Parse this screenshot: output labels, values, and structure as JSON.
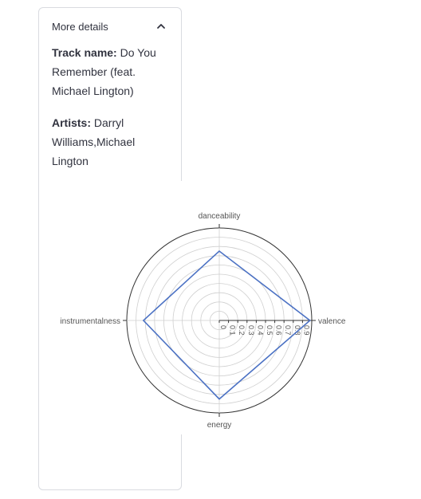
{
  "expander": {
    "title": "More details",
    "track_label": "Track name:",
    "track_value": "Do You Remember (feat. Michael Lington)",
    "artists_label": "Artists:",
    "artists_value": "Darryl Williams,Michael Lington"
  },
  "icons": {
    "collapse": "chevron-up-icon"
  },
  "chart_data": {
    "type": "radar",
    "categories": [
      "valence",
      "danceability",
      "instrumentalness",
      "energy"
    ],
    "values": [
      0.98,
      0.75,
      0.82,
      0.85
    ],
    "radial_ticks": [
      "0",
      "0.1",
      "0.2",
      "0.3",
      "0.4",
      "0.5",
      "0.6",
      "0.7",
      "0.8",
      "0.9"
    ],
    "rlim": [
      0,
      1
    ],
    "line_color": "#4c72c4",
    "grid": true
  }
}
